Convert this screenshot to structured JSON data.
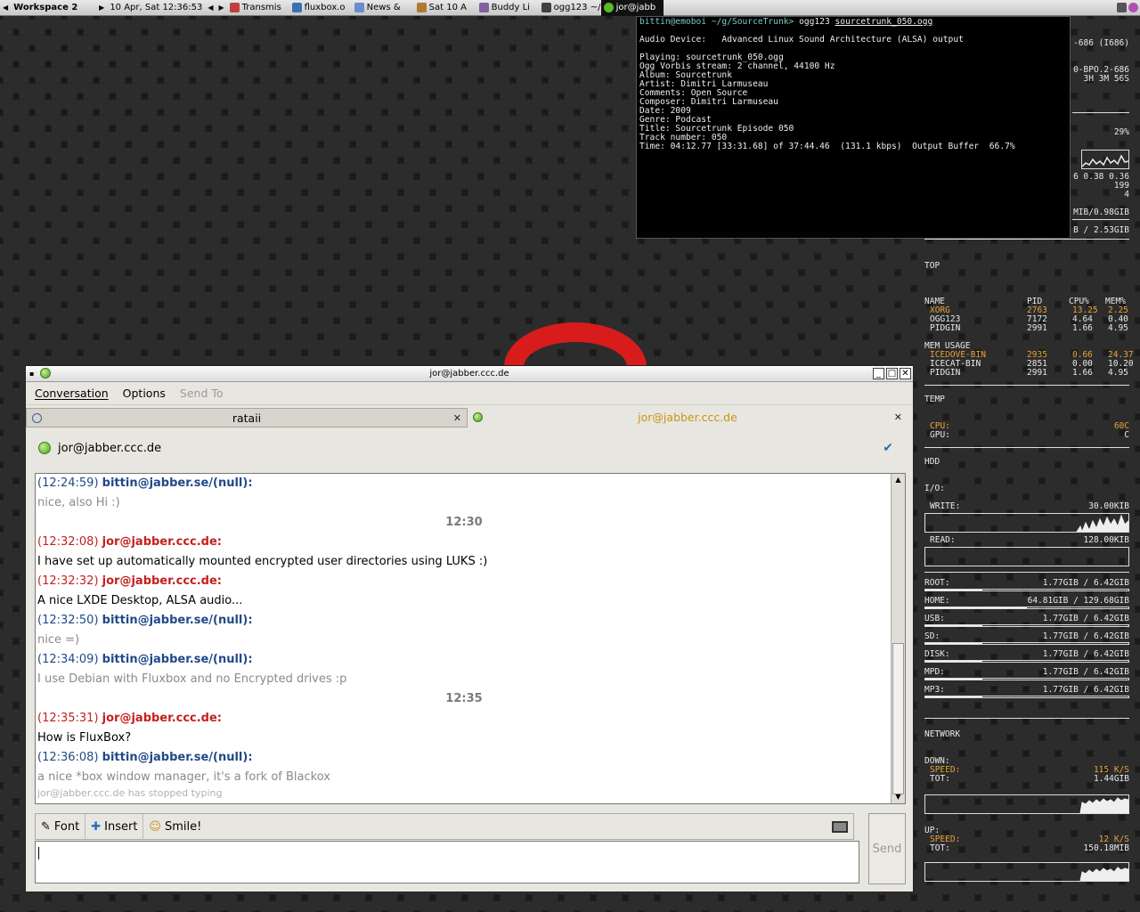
{
  "taskbar": {
    "workspace": "Workspace 2",
    "clock": "10 Apr, Sat 12:36:53",
    "tasks": [
      {
        "label": "Transmis",
        "icon": "transmission-icon",
        "color": "#c04040"
      },
      {
        "label": "fluxbox.o",
        "icon": "iceweasel-icon",
        "color": "#3b6fb6"
      },
      {
        "label": "News &",
        "icon": "newsreader-icon",
        "color": "#6a8bd0"
      },
      {
        "label": "Sat 10 A",
        "icon": "calendar-icon",
        "color": "#b07830"
      },
      {
        "label": "Buddy Li",
        "icon": "pidgin-icon",
        "color": "#8060a0"
      },
      {
        "label": "ogg123 ~/",
        "icon": "terminal-icon",
        "color": "#404040"
      },
      {
        "label": "jor@jabb",
        "icon": "jabber-status-icon",
        "color": "#5ab82a"
      }
    ]
  },
  "terminal": {
    "prompt_user": "bittin@emoboi",
    "prompt_path": "~/g/SourceTrunk>",
    "command": "ogg123",
    "file": "sourcetrunk_050.ogg",
    "device_line": "Audio Device:   Advanced Linux Sound Architecture (ALSA) output",
    "playing": "Playing: sourcetrunk_050.ogg",
    "stream": "Ogg Vorbis stream: 2 channel, 44100 Hz",
    "album": "Album: Sourcetrunk",
    "artist": "Artist: Dimitri Larmuseau",
    "comments": "Comments: Open Source",
    "composer": "Composer: Dimitri Larmuseau",
    "date": "Date: 2009",
    "genre": "Genre: Podcast",
    "title": "Title: Sourcetrunk Episode 050",
    "track": "Track number: 050",
    "time": "Time: 04:12.77 [33:31.68] of 37:44.46  (131.1 kbps)  Output Buffer  66.7%"
  },
  "conky": {
    "sys_1": "-686 (I686)",
    "sys_2": "0-BPO.2-686",
    "sys_3": "3H 3M 56S",
    "cpu_pct": "29%",
    "load": "6 0.38 0.36",
    "procs": "199",
    "running": "4",
    "mem": "MIB/0.98GIB",
    "swap": "B / 2.53GIB",
    "top_header": "TOP",
    "cols": {
      "name": "NAME",
      "pid": "PID",
      "cpu": "CPU%",
      "mem": "MEM%"
    },
    "top_rows": [
      {
        "name": "XORG",
        "pid": "2763",
        "cpu": "13.25",
        "mem": "2.25",
        "hl": true
      },
      {
        "name": "OGG123",
        "pid": "7172",
        "cpu": "4.64",
        "mem": "0.40",
        "hl": false
      },
      {
        "name": "PIDGIN",
        "pid": "2991",
        "cpu": "1.66",
        "mem": "4.95",
        "hl": false
      }
    ],
    "mem_header": "MEM USAGE",
    "mem_rows": [
      {
        "name": "ICEDOVE-BIN",
        "pid": "2935",
        "cpu": "0.66",
        "mem": "24.37",
        "hl": true
      },
      {
        "name": "ICECAT-BIN",
        "pid": "2851",
        "cpu": "0.00",
        "mem": "10.20",
        "hl": false
      },
      {
        "name": "PIDGIN",
        "pid": "2991",
        "cpu": "1.66",
        "mem": "4.95",
        "hl": false
      }
    ],
    "temp_header": "TEMP",
    "cpu_temp_label": "CPU:",
    "cpu_temp": "60C",
    "gpu_temp_label": "GPU:",
    "gpu_temp": "C",
    "hdd_header": "HDD",
    "io_label": "I/O:",
    "write_label": "WRITE:",
    "write_val": "30.00KIB",
    "read_label": "READ:",
    "read_val": "128.00KIB",
    "disks": [
      {
        "label": "ROOT:",
        "val": "1.77GIB / 6.42GIB",
        "fill": 0.28
      },
      {
        "label": "HOME:",
        "val": "64.81GIB / 129.68GIB",
        "fill": 0.5
      },
      {
        "label": "USB:",
        "val": "1.77GIB / 6.42GIB",
        "fill": 0.28
      },
      {
        "label": "SD:",
        "val": "1.77GIB / 6.42GIB",
        "fill": 0.28
      },
      {
        "label": "DISK:",
        "val": "1.77GIB / 6.42GIB",
        "fill": 0.28
      },
      {
        "label": "MPD:",
        "val": "1.77GIB / 6.42GIB",
        "fill": 0.28
      },
      {
        "label": "MP3:",
        "val": "1.77GIB / 6.42GIB",
        "fill": 0.28
      }
    ],
    "net_header": "NETWORK",
    "down_label": "DOWN:",
    "down_speed_label": "SPEED:",
    "down_speed": "115 K/S",
    "down_tot_label": "TOT:",
    "down_tot": "1.44GIB",
    "up_label": "UP:",
    "up_speed_label": "SPEED:",
    "up_speed": "12 K/S",
    "up_tot_label": "TOT:",
    "up_tot": "150.18MIB"
  },
  "pidgin": {
    "window_title": "jor@jabber.ccc.de",
    "menu": {
      "conversation": "Conversation",
      "options": "Options",
      "sendto": "Send To"
    },
    "tabs": [
      {
        "label": "rataii",
        "active": false
      },
      {
        "label": "jor@jabber.ccc.de",
        "active": true
      }
    ],
    "buddy": "jor@jabber.ccc.de",
    "messages": [
      {
        "kind": "nick",
        "who": "me",
        "time": "(12:24:59)",
        "nick": "bittin@jabber.se/(null):"
      },
      {
        "kind": "text",
        "who": "me",
        "text": "nice, also Hi :)"
      },
      {
        "kind": "sep",
        "text": "12:30"
      },
      {
        "kind": "nick",
        "who": "them",
        "time": "(12:32:08)",
        "nick": "jor@jabber.ccc.de:"
      },
      {
        "kind": "text",
        "who": "them",
        "text": "I have set up automatically mounted encrypted user directories using LUKS :)"
      },
      {
        "kind": "nick",
        "who": "them",
        "time": "(12:32:32)",
        "nick": "jor@jabber.ccc.de:"
      },
      {
        "kind": "text",
        "who": "them",
        "text": "A nice LXDE Desktop, ALSA audio..."
      },
      {
        "kind": "nick",
        "who": "me",
        "time": "(12:32:50)",
        "nick": "bittin@jabber.se/(null):"
      },
      {
        "kind": "text",
        "who": "me",
        "text": "nice =)"
      },
      {
        "kind": "nick",
        "who": "me",
        "time": "(12:34:09)",
        "nick": "bittin@jabber.se/(null):"
      },
      {
        "kind": "text",
        "who": "me",
        "text": "I use Debian with Fluxbox and no Encrypted drives :p"
      },
      {
        "kind": "sep",
        "text": "12:35"
      },
      {
        "kind": "nick",
        "who": "them",
        "time": "(12:35:31)",
        "nick": "jor@jabber.ccc.de:"
      },
      {
        "kind": "text",
        "who": "them",
        "text": "How is FluxBox?"
      },
      {
        "kind": "nick",
        "who": "me",
        "time": "(12:36:08)",
        "nick": "bittin@jabber.se/(null):"
      },
      {
        "kind": "text",
        "who": "me",
        "text": "a nice *box window manager, it's a fork of Blackox"
      }
    ],
    "typing_notice": "jor@jabber.ccc.de has stopped typing",
    "toolbar": {
      "font": "Font",
      "insert": "Insert",
      "smile": "Smile!"
    },
    "send": "Send"
  }
}
